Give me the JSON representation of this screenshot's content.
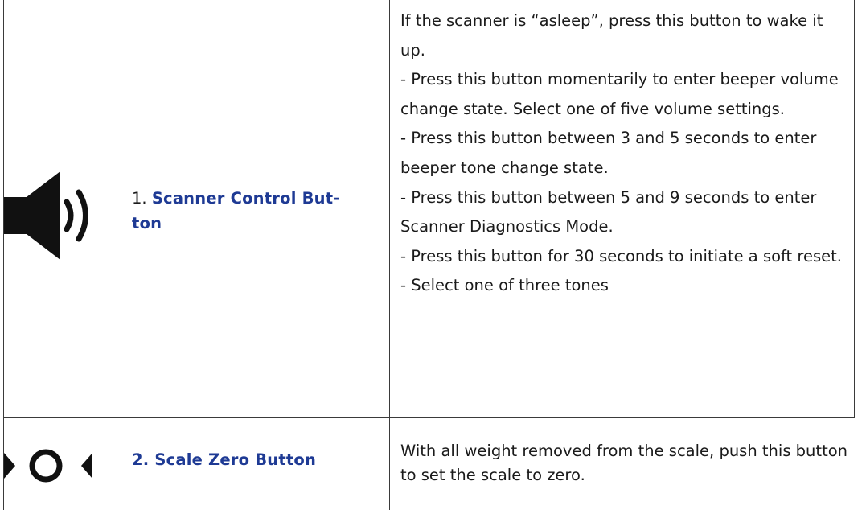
{
  "rows": [
    {
      "icon": "speaker-icon",
      "label_number": "1. ",
      "label_title": "Scanner Control Button",
      "label_title_line1": "Scanner Control But-",
      "label_title_line2": "ton",
      "description": [
        "If the scanner is “asleep”, press this button to wake it up.",
        "- Press this button momentarily to enter beeper volume change state. Select one of five volume settings.",
        "- Press this button between 3 and 5 seconds to enter beeper tone change state.",
        "- Press this button between 5 and 9 seconds to enter Scanner Diagnostics Mode.",
        "- Press this button for 30 seconds to initiate a soft reset.",
        "- Select one of three tones"
      ]
    },
    {
      "icon": "scale-zero-icon",
      "label_title": "2. Scale Zero Button",
      "description": [
        "With all weight removed from the scale, push this button to set the scale to zero."
      ]
    }
  ],
  "colors": {
    "label_accent": "#1e3a94",
    "text": "#1a1a1a",
    "grid": "#3a3a3a"
  }
}
